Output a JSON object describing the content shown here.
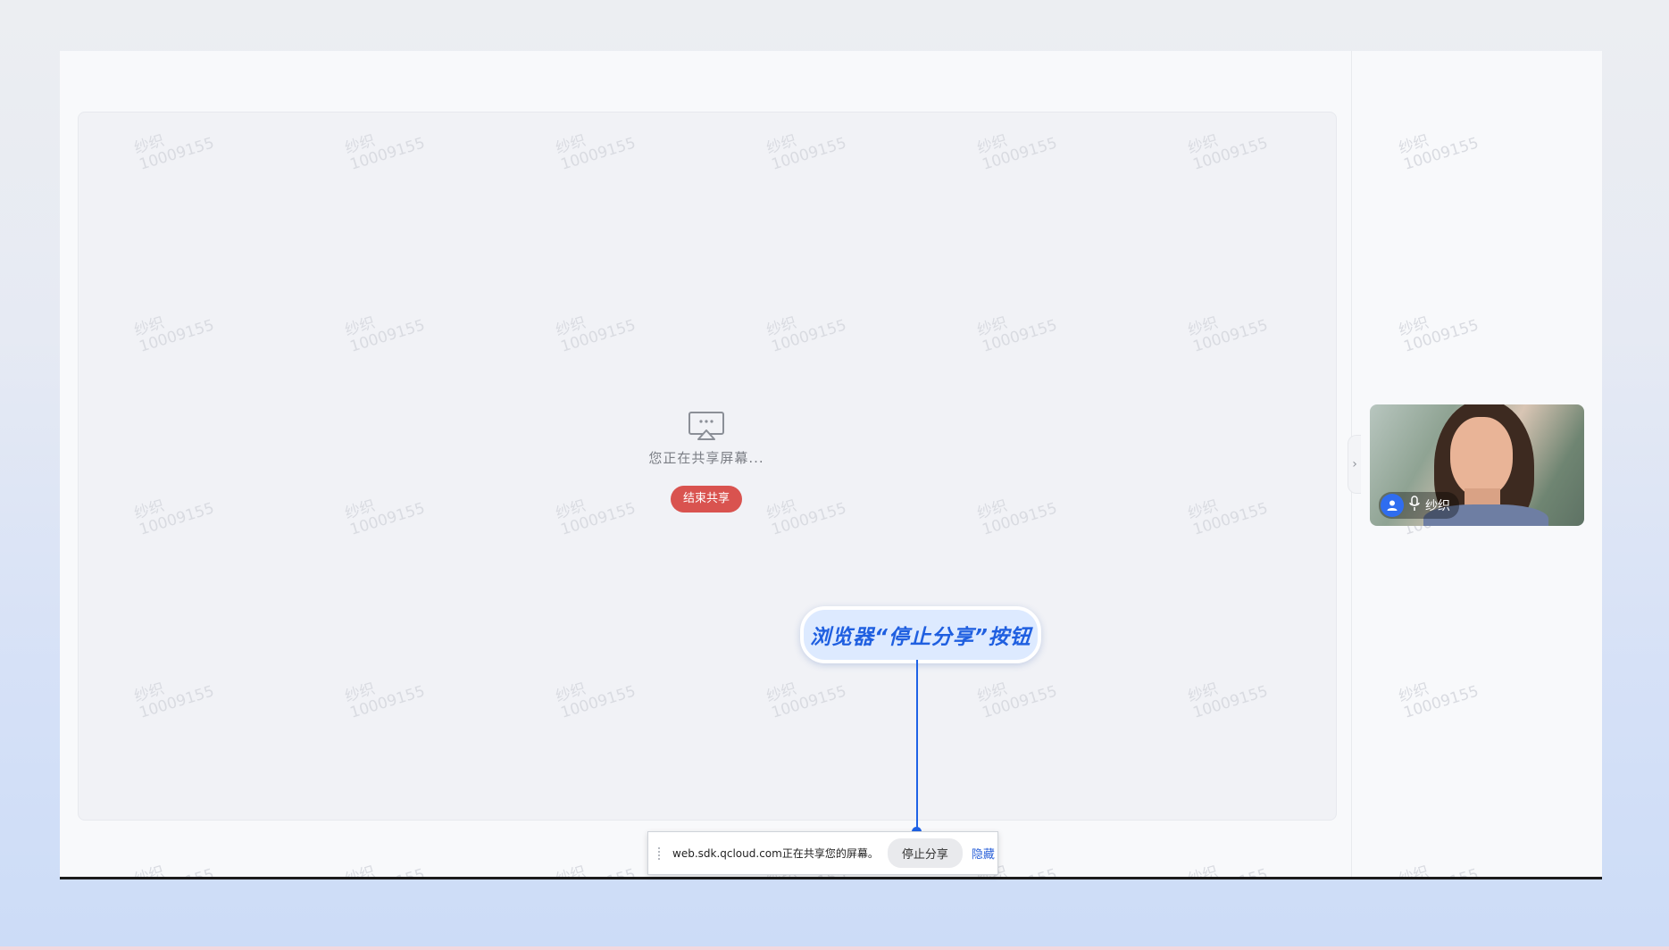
{
  "watermark": {
    "name": "纱织",
    "id": "10009155"
  },
  "share": {
    "status_text": "您正在共享屏幕...",
    "end_button": "结束共享"
  },
  "participant": {
    "name": "纱织",
    "mic_state": "muted-off"
  },
  "callout": {
    "text": "浏览器“停止分享”按钮"
  },
  "browser_bar": {
    "message": "web.sdk.qcloud.com正在共享您的屏幕。",
    "stop_button": "停止分享",
    "hide_link": "隐藏"
  },
  "colors": {
    "end_button": "#d9534f",
    "callout_text": "#1f5fe0",
    "callout_line": "#1e62e6",
    "avatar": "#2f6df0",
    "hide_link": "#2d63d9"
  },
  "icons": [
    "screen-share-icon",
    "chevron-right-icon",
    "user-icon",
    "microphone-icon",
    "grip-icon"
  ]
}
